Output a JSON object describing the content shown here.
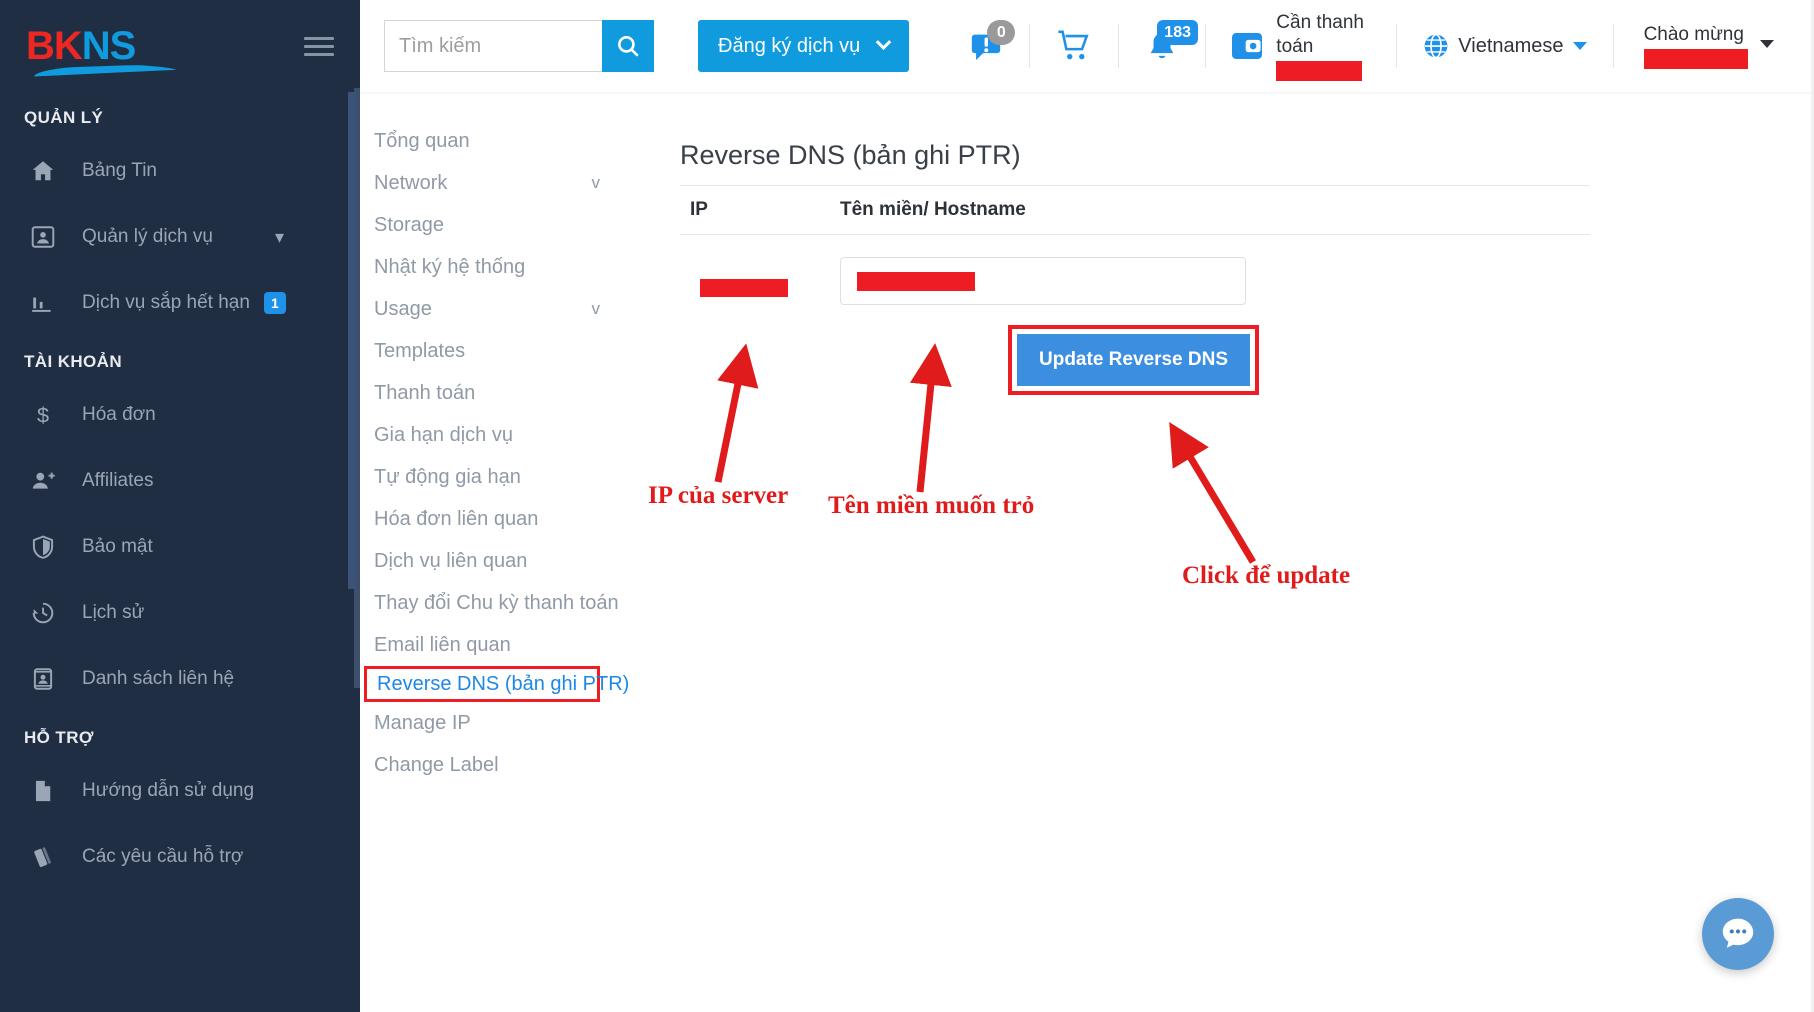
{
  "brand": {
    "part1": "BK",
    "part2": "NS"
  },
  "sidebar": {
    "sections": [
      {
        "title": "QUẢN LÝ",
        "items": [
          {
            "label": "Bảng Tin",
            "icon": "home-icon",
            "chevron": false,
            "badge": null
          },
          {
            "label": "Quản lý dịch vụ",
            "icon": "account-box-icon",
            "chevron": true,
            "badge": null
          },
          {
            "label": "Dịch vụ sắp hết hạn",
            "icon": "chart-icon",
            "chevron": false,
            "badge": "1"
          }
        ]
      },
      {
        "title": "TÀI KHOẢN",
        "items": [
          {
            "label": "Hóa đơn",
            "icon": "dollar-icon",
            "chevron": false,
            "badge": null
          },
          {
            "label": "Affiliates",
            "icon": "user-plus-icon",
            "chevron": false,
            "badge": null
          },
          {
            "label": "Bảo mật",
            "icon": "shield-icon",
            "chevron": false,
            "badge": null
          },
          {
            "label": "Lịch sử",
            "icon": "history-icon",
            "chevron": false,
            "badge": null
          },
          {
            "label": "Danh sách liên hệ",
            "icon": "contacts-icon",
            "chevron": false,
            "badge": null
          }
        ]
      },
      {
        "title": "HỖ TRỢ",
        "items": [
          {
            "label": "Hướng dẫn sử dụng",
            "icon": "document-icon",
            "chevron": false,
            "badge": null
          },
          {
            "label": "Các yêu cầu hỗ trợ",
            "icon": "ticket-icon",
            "chevron": false,
            "badge": null
          }
        ]
      }
    ]
  },
  "header": {
    "search": {
      "placeholder": "Tìm kiếm",
      "value": "",
      "icon": "search-icon"
    },
    "register_button": {
      "label": "Đăng ký dịch vụ",
      "icon": "chevron-down-icon"
    },
    "chat_badge": "0",
    "cart_icon": "cart-icon",
    "bell_badge": "183",
    "payment": {
      "label": "Cần thanh toán",
      "value_redacted": true,
      "icon": "wallet-icon"
    },
    "language": {
      "label": "Vietnamese",
      "icon": "globe-icon"
    },
    "welcome": {
      "label": "Chào mừng",
      "value_redacted": true,
      "icon": "caret-down-icon"
    }
  },
  "subnav": {
    "items": [
      {
        "label": "Tổng quan",
        "chevron": "",
        "active": false
      },
      {
        "label": "Network",
        "chevron": "v",
        "active": false
      },
      {
        "label": "Storage",
        "chevron": "",
        "active": false
      },
      {
        "label": "Nhật ký hệ thống",
        "chevron": "",
        "active": false
      },
      {
        "label": "Usage",
        "chevron": "v",
        "active": false
      },
      {
        "label": "Templates",
        "chevron": "",
        "active": false
      },
      {
        "label": "Thanh toán",
        "chevron": "",
        "active": false
      },
      {
        "label": "Gia hạn dịch vụ",
        "chevron": "",
        "active": false
      },
      {
        "label": "Tự động gia hạn",
        "chevron": "",
        "active": false
      },
      {
        "label": "Hóa đơn liên quan",
        "chevron": "",
        "active": false
      },
      {
        "label": "Dịch vụ liên quan",
        "chevron": "",
        "active": false
      },
      {
        "label": "Thay đổi Chu kỳ thanh toán",
        "chevron": "",
        "active": false
      },
      {
        "label": "Email liên quan",
        "chevron": "",
        "active": false
      },
      {
        "label": "Reverse DNS (bản ghi PTR)",
        "chevron": "",
        "active": true
      },
      {
        "label": "Manage IP",
        "chevron": "",
        "active": false
      },
      {
        "label": "Change Label",
        "chevron": "",
        "active": false
      }
    ]
  },
  "main": {
    "title": "Reverse DNS (bản ghi PTR)",
    "columns": {
      "ip": "IP",
      "hostname": "Tên miền/ Hostname"
    },
    "row": {
      "ip_redacted": true,
      "hostname_redacted": true
    },
    "update_button": "Update Reverse DNS"
  },
  "annotations": [
    {
      "text": "IP của server",
      "name": "annotation-ip"
    },
    {
      "text": "Tên miền muốn trỏ",
      "name": "annotation-hostname"
    },
    {
      "text": "Click để update",
      "name": "annotation-update"
    }
  ],
  "chat_widget": {
    "icon": "chat-bubble-icon"
  },
  "colors": {
    "brand_red": "#ee2722",
    "brand_blue": "#0f9bdd",
    "sidebar": "#202e44",
    "annotation_red": "#e01b1b",
    "accent_blue": "#1e88e5"
  }
}
